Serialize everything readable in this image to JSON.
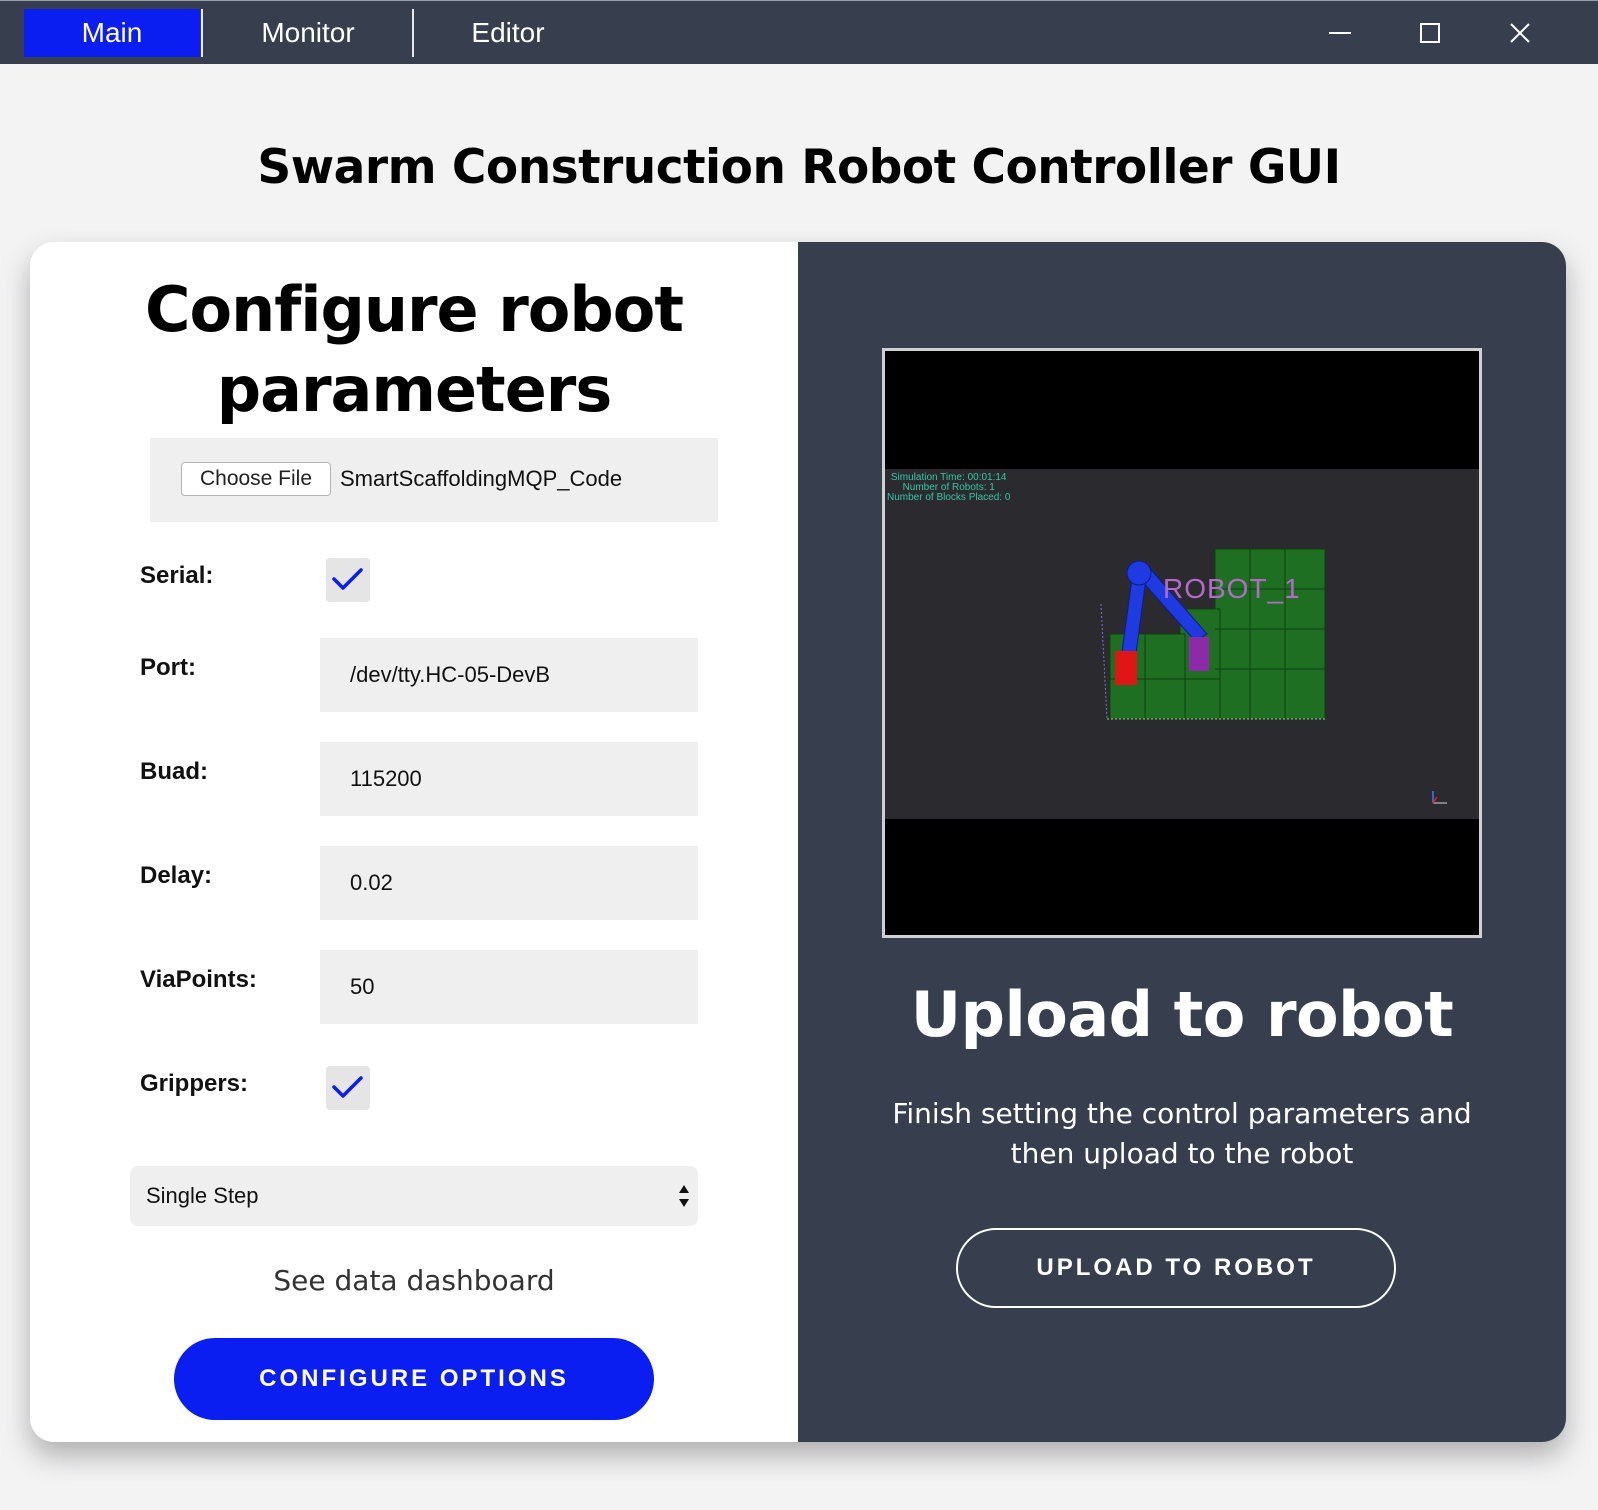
{
  "tabs": [
    {
      "label": "Main",
      "active": true
    },
    {
      "label": "Monitor",
      "active": false
    },
    {
      "label": "Editor",
      "active": false
    }
  ],
  "window_controls": [
    "minimize-icon",
    "maximize-icon",
    "close-icon"
  ],
  "page_title": "Swarm Construction Robot Controller GUI",
  "configure": {
    "title_line1": "Configure robot",
    "title_line2": "parameters",
    "file_button": "Choose File",
    "file_name": "SmartScaffoldingMQP_Code",
    "serial_label": "Serial:",
    "serial_checked": true,
    "port_label": "Port:",
    "port_value": "/dev/tty.HC-05-DevB",
    "baud_label": "Buad:",
    "baud_value": "115200",
    "delay_label": "Delay:",
    "delay_value": "0.02",
    "viapoints_label": "ViaPoints:",
    "viapoints_value": "50",
    "grippers_label": "Grippers:",
    "grippers_checked": true,
    "mode_selected": "Single Step",
    "dashboard_link": "See data dashboard",
    "configure_button": "CONFIGURE OPTIONS"
  },
  "upload": {
    "sim_info": [
      "Simulation Time: 00:01:14",
      "Number of Robots: 1",
      "Number of Blocks Placed: 0"
    ],
    "robot_label": "ROBOT_1",
    "title": "Upload to robot",
    "description": "Finish setting the control parameters and then upload to the robot",
    "button": "UPLOAD TO ROBOT"
  },
  "colors": {
    "accent": "#0a1ef2",
    "titlebar": "#373f4e",
    "panel_dark": "#373f4e"
  }
}
